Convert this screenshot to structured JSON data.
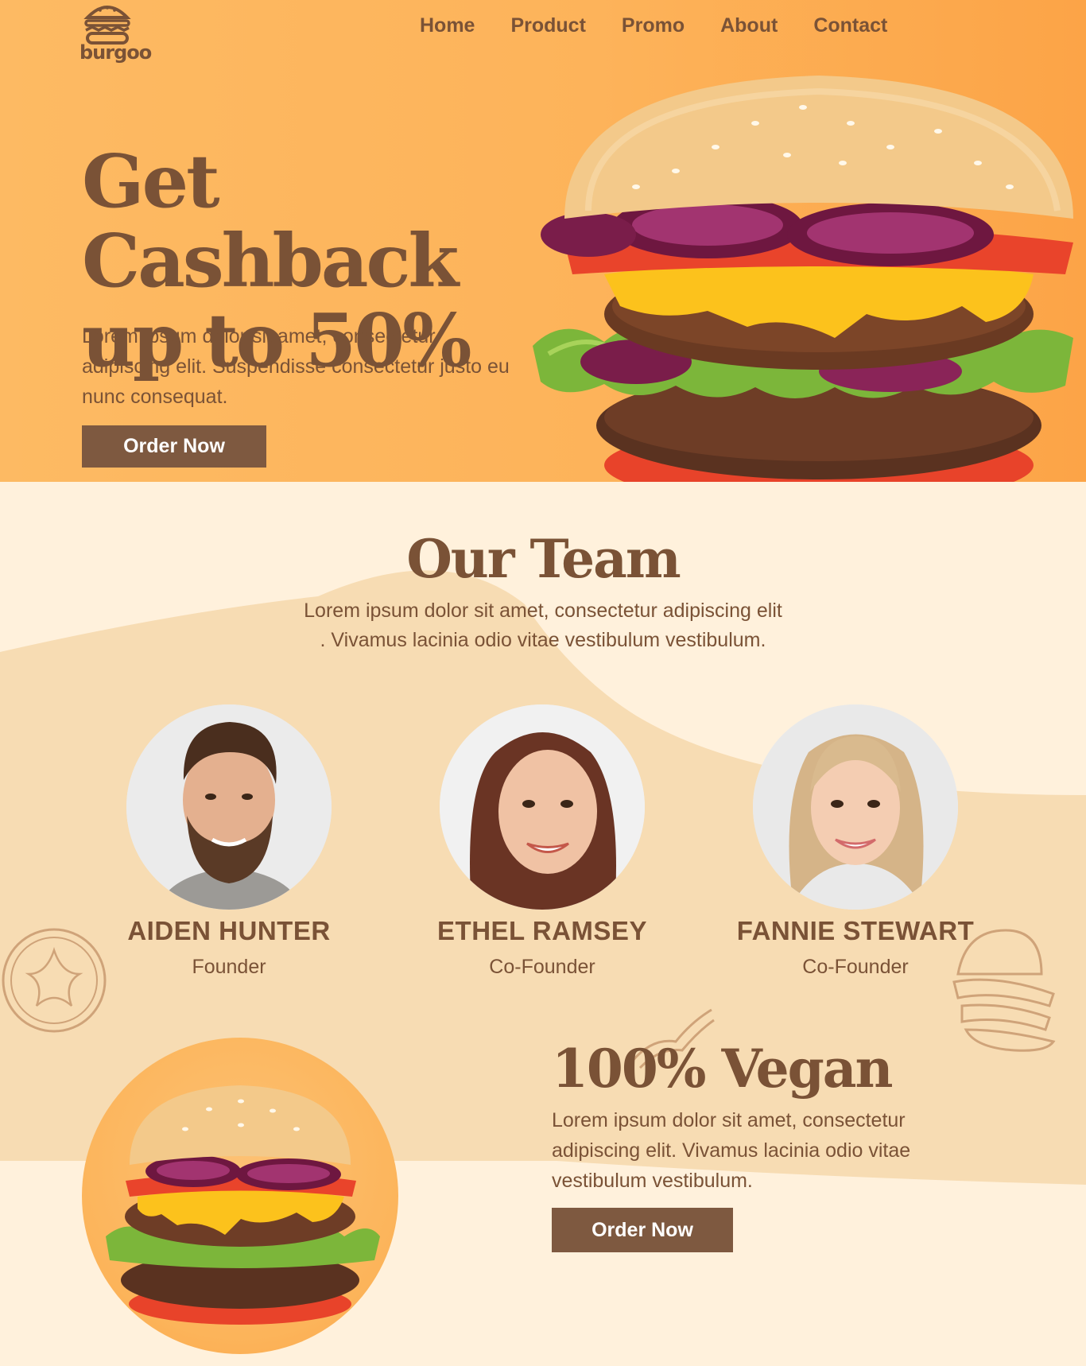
{
  "brand": {
    "name": "burgoo",
    "icon": "burger-logo-icon"
  },
  "nav": {
    "items": [
      "Home",
      "Product",
      "Promo",
      "About",
      "Contact"
    ]
  },
  "hero": {
    "title_line1": "Get Cashback",
    "title_line2": "up to 50%",
    "text": "Lorem ipsum dolor sit amet, consectetur adipiscing elit. Suspendisse consectetur justo eu nunc consequat.",
    "button": "Order Now"
  },
  "team": {
    "title": "Our Team",
    "subtitle_line1": "Lorem ipsum dolor sit amet, consectetur adipiscing elit",
    "subtitle_line2": ". Vivamus lacinia odio vitae vestibulum vestibulum.",
    "members": [
      {
        "name": "AIDEN HUNTER",
        "role": "Founder"
      },
      {
        "name": "ETHEL RAMSEY",
        "role": "Co-Founder"
      },
      {
        "name": "FANNIE STEWART",
        "role": "Co-Founder"
      }
    ]
  },
  "vegan": {
    "title": "100% Vegan",
    "text": "Lorem ipsum dolor sit amet, consectetur adipiscing elit. Vivamus lacinia odio vitae vestibulum vestibulum.",
    "button": "Order Now"
  },
  "colors": {
    "brown": "#7a5236",
    "button": "#7e5940",
    "orange": "#fdb35a",
    "cream": "#fff1dc",
    "blob": "#f7dcb3"
  }
}
